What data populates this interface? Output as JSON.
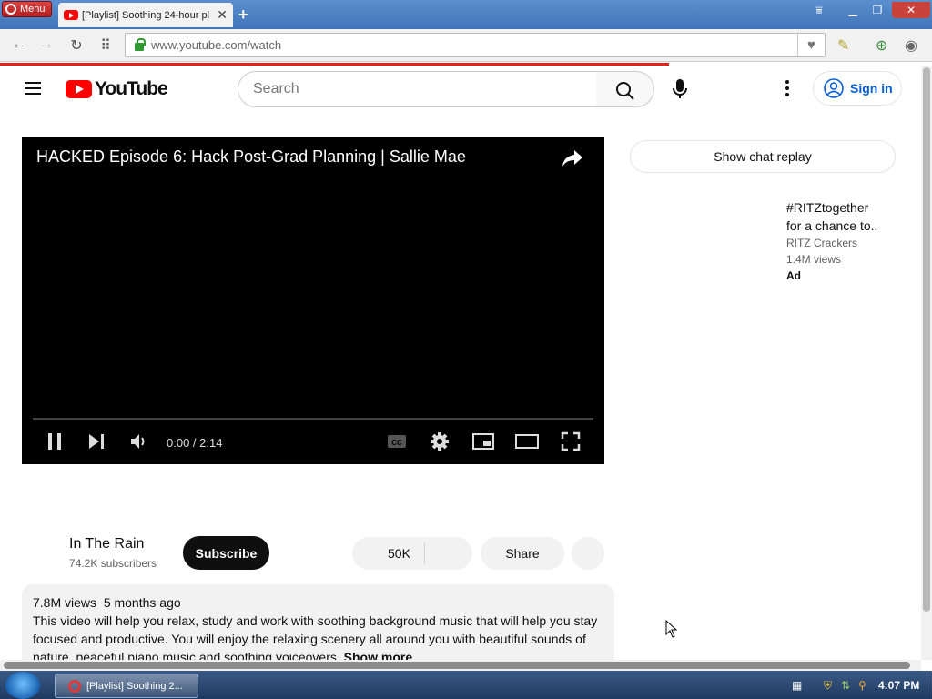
{
  "browser": {
    "menu_label": "Menu",
    "tab_title": "[Playlist] Soothing 24-hour pl",
    "url": "www.youtube.com/watch"
  },
  "masthead": {
    "logo_text": "YouTube",
    "search_placeholder": "Search",
    "signin_label": "Sign in"
  },
  "player": {
    "title": "HACKED Episode 6: Hack Post-Grad Planning | Sallie Mae",
    "time": "0:00 / 2:14",
    "progress_fraction": 0.0
  },
  "sidebar": {
    "chat_replay_label": "Show chat replay",
    "ad": {
      "title_line1": "#RITZtogether",
      "title_line2": "for a chance to..",
      "channel": "RITZ Crackers",
      "views": "1.4M views",
      "badge": "Ad"
    }
  },
  "owner": {
    "channel_name": "In The Rain",
    "subscribers": "74.2K subscribers",
    "subscribe_label": "Subscribe",
    "like_count": "50K",
    "share_label": "Share"
  },
  "description": {
    "views": "7.8M views",
    "age": "5 months ago",
    "text": "This video will help you relax, study and work with soothing background music that will help you stay focused and productive. You will enjoy the relaxing scenery all around you with beautiful sounds of nature, peaceful piano music and soothing voiceovers.",
    "show_more": "Show more"
  },
  "taskbar": {
    "task_label": "[Playlist] Soothing 2...",
    "clock": "4:07 PM"
  },
  "colors": {
    "yt_red": "#ff0000",
    "link_blue": "#065fd4",
    "load_bar": "#e62117"
  }
}
